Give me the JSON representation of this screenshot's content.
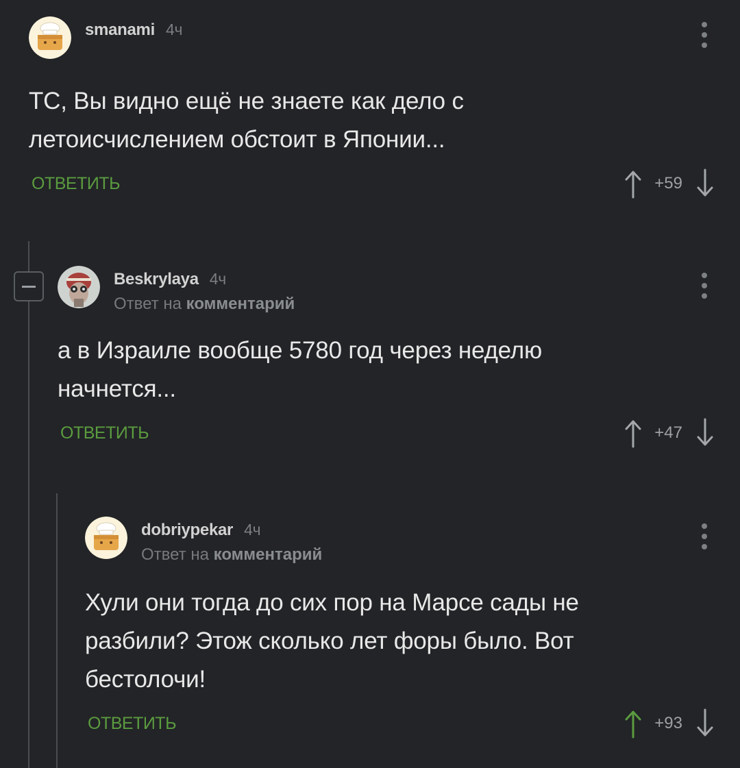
{
  "comments": [
    {
      "username": "smanami",
      "time": "4ч",
      "reply_prefix": "",
      "reply_target": "",
      "text_lines": [
        "ТС, Вы видно ещё не знаете как дело с",
        "летоисчислением обстоит в Японии..."
      ],
      "reply_label": "ОТВЕТИТЬ",
      "score": "+59",
      "upvoted": false,
      "avatar": "chef-avatar"
    },
    {
      "username": "Beskrylaya",
      "time": "4ч",
      "reply_prefix": "Ответ на",
      "reply_target": "комментарий",
      "text_lines": [
        "а в Израиле вообще 5780 год через неделю",
        "начнется..."
      ],
      "reply_label": "ОТВЕТИТЬ",
      "score": "+47",
      "upvoted": false,
      "avatar": "photo-avatar"
    },
    {
      "username": "dobriypekar",
      "time": "4ч",
      "reply_prefix": "Ответ на",
      "reply_target": "комментарий",
      "text_lines": [
        "Хули они тогда до сих пор на Марсе сады не",
        "разбили? Этож сколько лет форы было. Вот",
        "бестолочи!"
      ],
      "reply_label": "ОТВЕТИТЬ",
      "score": "+93",
      "upvoted": true,
      "avatar": "chef-avatar"
    }
  ],
  "colors": {
    "background": "#222427",
    "accent_green": "#5b9b3f",
    "text": "#e8e8e8",
    "muted": "#7a7d81",
    "thread_line": "#4a4d51"
  },
  "icons": [
    "collapse-icon",
    "menu-dots-icon",
    "upvote-arrow-icon",
    "downvote-arrow-icon"
  ]
}
